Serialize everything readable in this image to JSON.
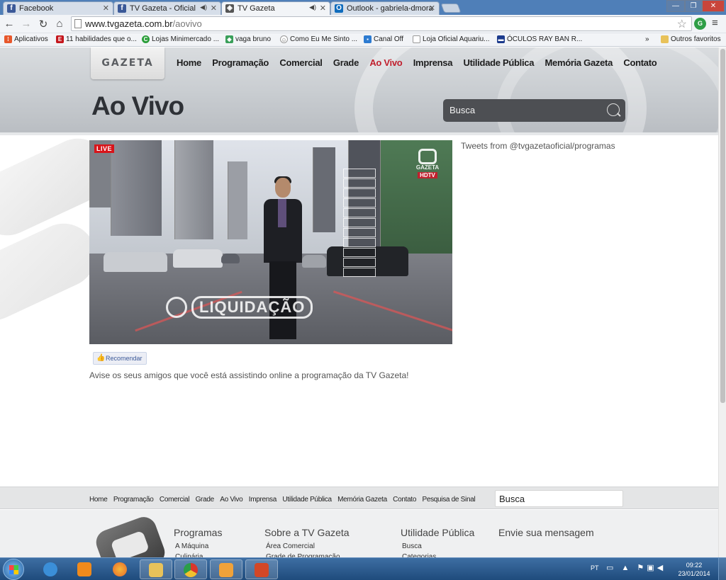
{
  "browser": {
    "tabs": [
      {
        "title": "Facebook",
        "icon": "facebook-icon"
      },
      {
        "title": "TV Gazeta - Oficial",
        "icon": "facebook-icon"
      },
      {
        "title": "TV Gazeta",
        "icon": "tv-gazeta-icon"
      },
      {
        "title": "Outlook - gabriela-dmora",
        "icon": "outlook-icon"
      }
    ],
    "active_tab": 2,
    "url_host": "www.tvgazeta.com.br",
    "url_path": "/aovivo",
    "bookmarks": [
      {
        "label": "Aplicativos",
        "icon": "apps-icon",
        "color": "#e7572b"
      },
      {
        "label": "11 habilidades que o...",
        "icon": "e-icon",
        "color": "#c4161c"
      },
      {
        "label": "Lojas Minimercado ...",
        "icon": "c-icon",
        "color": "#2b9e3a"
      },
      {
        "label": "vaga bruno",
        "icon": "diamond-icon",
        "color": "#3a9f5a"
      },
      {
        "label": "Como Eu Me Sinto ...",
        "icon": "smile-icon",
        "color": "#777777"
      },
      {
        "label": "Canal Off",
        "icon": "off-icon",
        "color": "#2d7bd1"
      },
      {
        "label": "Loja Oficial Aquariu...",
        "icon": "page-icon",
        "color": "#999999"
      },
      {
        "label": "ÓCULOS RAY BAN R...",
        "icon": "rayban-icon",
        "color": "#1b3a8c"
      }
    ],
    "other_bookmarks": "Outros favoritos",
    "overflow": "»"
  },
  "site": {
    "logo": "GAZETA",
    "nav": [
      "Home",
      "Programação",
      "Comercial",
      "Grade",
      "Ao Vivo",
      "Imprensa",
      "Utilidade Pública",
      "Memória Gazeta",
      "Contato"
    ],
    "active_nav": "Ao Vivo",
    "page_title": "Ao Vivo",
    "search_placeholder": "Busca",
    "live_badge": "LIVE",
    "video_overlay_text": "LIQUIDAÇÃO",
    "video_watermark": "GAZETA",
    "video_watermark_hd": "HDTV",
    "tweets_label": "Tweets from @tvgazetaoficial/programas",
    "recommend_label": "Recomendar",
    "invite_text": "Avise os seus amigos que você está assistindo online a programação da TV Gazeta!",
    "footer_nav": [
      "Home",
      "Programação",
      "Comercial",
      "Grade",
      "Ao Vivo",
      "Imprensa",
      "Utilidade Pública",
      "Memória Gazeta",
      "Contato",
      "Pesquisa de Sinal"
    ],
    "footer_search": "Busca",
    "footer_columns": [
      {
        "heading": "Programas",
        "links": [
          "A Máquina",
          "Culinária"
        ]
      },
      {
        "heading": "Sobre a TV Gazeta",
        "links": [
          "Área Comercial",
          "Grade de Programação"
        ]
      },
      {
        "heading": "Utilidade Pública",
        "links": [
          "Busca",
          "Categorias"
        ]
      },
      {
        "heading": "Envie sua mensagem",
        "links": []
      }
    ]
  },
  "taskbar": {
    "apps": [
      {
        "name": "internet-explorer",
        "color": "#3b8fd8"
      },
      {
        "name": "media-player",
        "color": "#f08a1c"
      },
      {
        "name": "firefox",
        "color": "#e8692a"
      },
      {
        "name": "file-explorer",
        "color": "#e8c25a"
      },
      {
        "name": "chrome",
        "color": "#d9362b"
      },
      {
        "name": "outlook",
        "color": "#f0a23a"
      },
      {
        "name": "powerpoint",
        "color": "#d24726"
      }
    ],
    "language": "PT",
    "time": "09:22",
    "date": "23/01/2014"
  },
  "colors": {
    "accent_red": "#c0202e",
    "nav_text": "#1d1d1d",
    "taskbar": "#2a5a8e"
  }
}
